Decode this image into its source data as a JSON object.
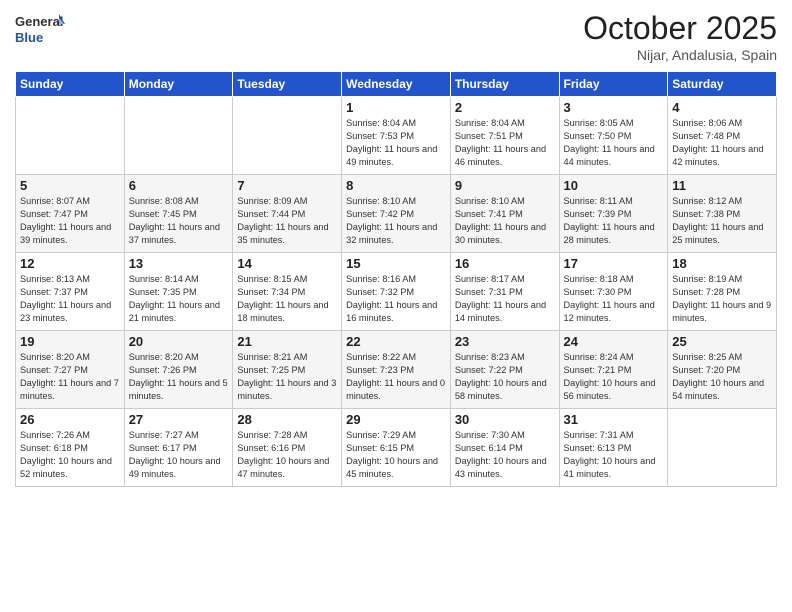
{
  "logo": {
    "general": "General",
    "blue": "Blue"
  },
  "title": "October 2025",
  "subtitle": "Nijar, Andalusia, Spain",
  "days_of_week": [
    "Sunday",
    "Monday",
    "Tuesday",
    "Wednesday",
    "Thursday",
    "Friday",
    "Saturday"
  ],
  "weeks": [
    [
      {
        "day": "",
        "info": ""
      },
      {
        "day": "",
        "info": ""
      },
      {
        "day": "",
        "info": ""
      },
      {
        "day": "1",
        "info": "Sunrise: 8:04 AM\nSunset: 7:53 PM\nDaylight: 11 hours and 49 minutes."
      },
      {
        "day": "2",
        "info": "Sunrise: 8:04 AM\nSunset: 7:51 PM\nDaylight: 11 hours and 46 minutes."
      },
      {
        "day": "3",
        "info": "Sunrise: 8:05 AM\nSunset: 7:50 PM\nDaylight: 11 hours and 44 minutes."
      },
      {
        "day": "4",
        "info": "Sunrise: 8:06 AM\nSunset: 7:48 PM\nDaylight: 11 hours and 42 minutes."
      }
    ],
    [
      {
        "day": "5",
        "info": "Sunrise: 8:07 AM\nSunset: 7:47 PM\nDaylight: 11 hours and 39 minutes."
      },
      {
        "day": "6",
        "info": "Sunrise: 8:08 AM\nSunset: 7:45 PM\nDaylight: 11 hours and 37 minutes."
      },
      {
        "day": "7",
        "info": "Sunrise: 8:09 AM\nSunset: 7:44 PM\nDaylight: 11 hours and 35 minutes."
      },
      {
        "day": "8",
        "info": "Sunrise: 8:10 AM\nSunset: 7:42 PM\nDaylight: 11 hours and 32 minutes."
      },
      {
        "day": "9",
        "info": "Sunrise: 8:10 AM\nSunset: 7:41 PM\nDaylight: 11 hours and 30 minutes."
      },
      {
        "day": "10",
        "info": "Sunrise: 8:11 AM\nSunset: 7:39 PM\nDaylight: 11 hours and 28 minutes."
      },
      {
        "day": "11",
        "info": "Sunrise: 8:12 AM\nSunset: 7:38 PM\nDaylight: 11 hours and 25 minutes."
      }
    ],
    [
      {
        "day": "12",
        "info": "Sunrise: 8:13 AM\nSunset: 7:37 PM\nDaylight: 11 hours and 23 minutes."
      },
      {
        "day": "13",
        "info": "Sunrise: 8:14 AM\nSunset: 7:35 PM\nDaylight: 11 hours and 21 minutes."
      },
      {
        "day": "14",
        "info": "Sunrise: 8:15 AM\nSunset: 7:34 PM\nDaylight: 11 hours and 18 minutes."
      },
      {
        "day": "15",
        "info": "Sunrise: 8:16 AM\nSunset: 7:32 PM\nDaylight: 11 hours and 16 minutes."
      },
      {
        "day": "16",
        "info": "Sunrise: 8:17 AM\nSunset: 7:31 PM\nDaylight: 11 hours and 14 minutes."
      },
      {
        "day": "17",
        "info": "Sunrise: 8:18 AM\nSunset: 7:30 PM\nDaylight: 11 hours and 12 minutes."
      },
      {
        "day": "18",
        "info": "Sunrise: 8:19 AM\nSunset: 7:28 PM\nDaylight: 11 hours and 9 minutes."
      }
    ],
    [
      {
        "day": "19",
        "info": "Sunrise: 8:20 AM\nSunset: 7:27 PM\nDaylight: 11 hours and 7 minutes."
      },
      {
        "day": "20",
        "info": "Sunrise: 8:20 AM\nSunset: 7:26 PM\nDaylight: 11 hours and 5 minutes."
      },
      {
        "day": "21",
        "info": "Sunrise: 8:21 AM\nSunset: 7:25 PM\nDaylight: 11 hours and 3 minutes."
      },
      {
        "day": "22",
        "info": "Sunrise: 8:22 AM\nSunset: 7:23 PM\nDaylight: 11 hours and 0 minutes."
      },
      {
        "day": "23",
        "info": "Sunrise: 8:23 AM\nSunset: 7:22 PM\nDaylight: 10 hours and 58 minutes."
      },
      {
        "day": "24",
        "info": "Sunrise: 8:24 AM\nSunset: 7:21 PM\nDaylight: 10 hours and 56 minutes."
      },
      {
        "day": "25",
        "info": "Sunrise: 8:25 AM\nSunset: 7:20 PM\nDaylight: 10 hours and 54 minutes."
      }
    ],
    [
      {
        "day": "26",
        "info": "Sunrise: 7:26 AM\nSunset: 6:18 PM\nDaylight: 10 hours and 52 minutes."
      },
      {
        "day": "27",
        "info": "Sunrise: 7:27 AM\nSunset: 6:17 PM\nDaylight: 10 hours and 49 minutes."
      },
      {
        "day": "28",
        "info": "Sunrise: 7:28 AM\nSunset: 6:16 PM\nDaylight: 10 hours and 47 minutes."
      },
      {
        "day": "29",
        "info": "Sunrise: 7:29 AM\nSunset: 6:15 PM\nDaylight: 10 hours and 45 minutes."
      },
      {
        "day": "30",
        "info": "Sunrise: 7:30 AM\nSunset: 6:14 PM\nDaylight: 10 hours and 43 minutes."
      },
      {
        "day": "31",
        "info": "Sunrise: 7:31 AM\nSunset: 6:13 PM\nDaylight: 10 hours and 41 minutes."
      },
      {
        "day": "",
        "info": ""
      }
    ]
  ]
}
